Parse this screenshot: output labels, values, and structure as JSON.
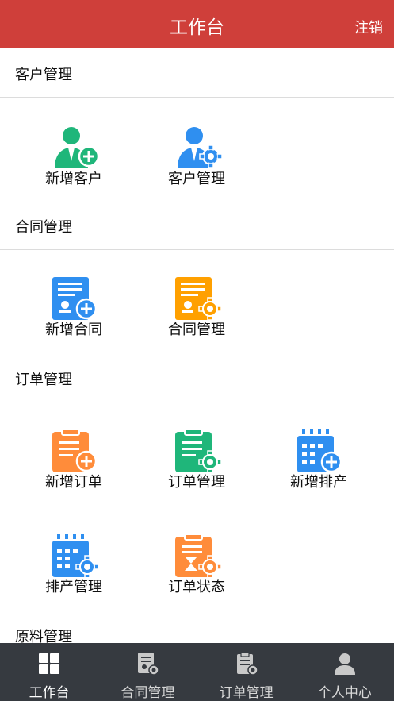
{
  "header": {
    "title": "工作台",
    "logout_label": "注销"
  },
  "sections": {
    "customer": {
      "title": "客户管理",
      "items": [
        {
          "label": "新增客户",
          "icon": "add-customer-icon"
        },
        {
          "label": "客户管理",
          "icon": "customer-settings-icon"
        }
      ]
    },
    "contract": {
      "title": "合同管理",
      "items": [
        {
          "label": "新增合同",
          "icon": "add-contract-icon"
        },
        {
          "label": "合同管理",
          "icon": "contract-settings-icon"
        }
      ]
    },
    "order": {
      "title": "订单管理",
      "items": [
        {
          "label": "新增订单",
          "icon": "add-order-icon"
        },
        {
          "label": "订单管理",
          "icon": "order-settings-icon"
        },
        {
          "label": "新增排产",
          "icon": "add-schedule-icon"
        },
        {
          "label": "排产管理",
          "icon": "schedule-settings-icon"
        },
        {
          "label": "订单状态",
          "icon": "order-status-icon"
        }
      ]
    },
    "material": {
      "title": "原料管理"
    }
  },
  "tabbar": {
    "tabs": [
      {
        "label": "工作台",
        "icon": "grid-icon"
      },
      {
        "label": "合同管理",
        "icon": "contract-tab-icon"
      },
      {
        "label": "订单管理",
        "icon": "order-tab-icon"
      },
      {
        "label": "个人中心",
        "icon": "person-icon"
      }
    ]
  },
  "colors": {
    "header_bg": "#cf3f3a",
    "tabbar_bg": "#363a40",
    "green": "#1fb67a",
    "blue": "#2f8ff0",
    "orange": "#ffa000",
    "orange_soft": "#ff8c3a"
  }
}
